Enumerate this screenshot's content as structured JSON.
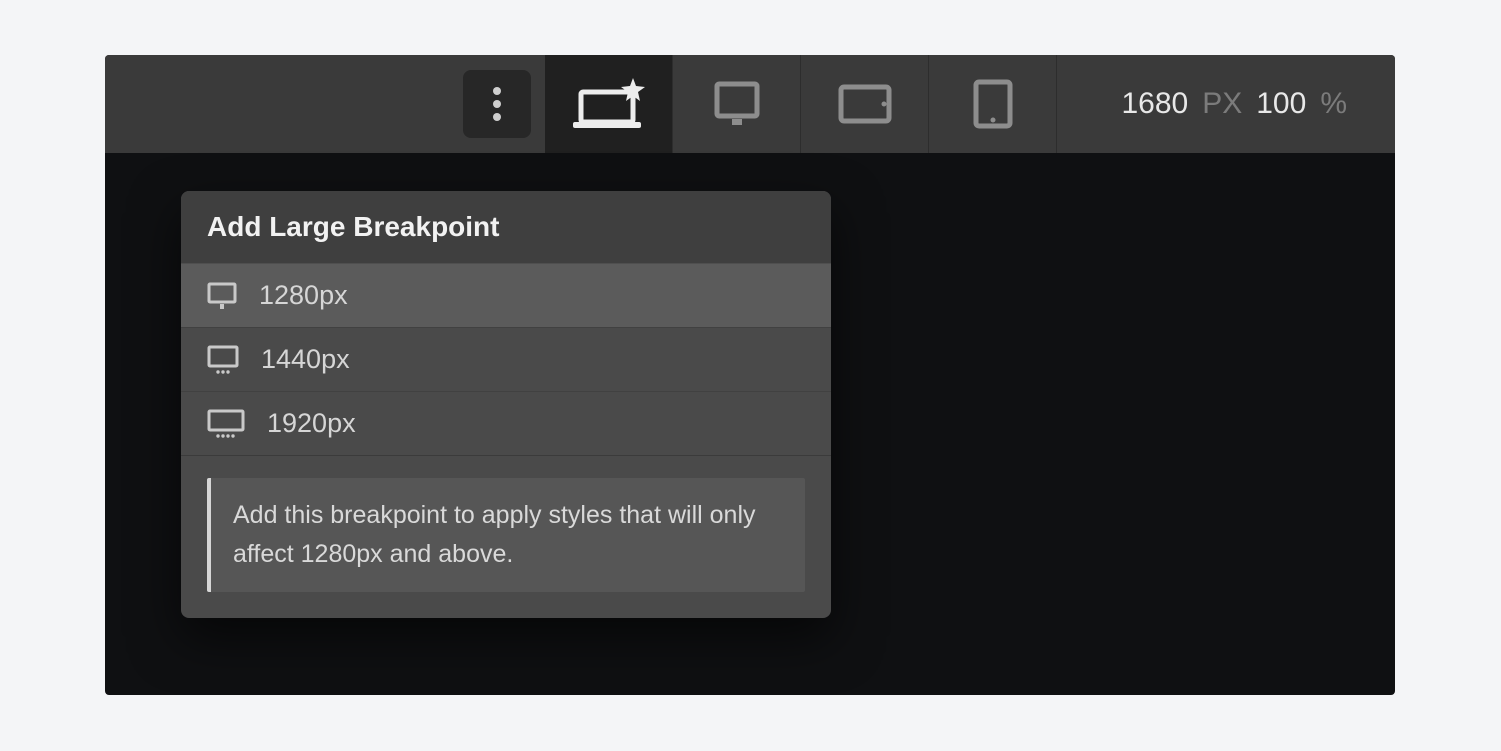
{
  "toolbar": {
    "width_value": "1680",
    "width_unit": "PX",
    "zoom_value": "100",
    "zoom_unit": "%"
  },
  "dropdown": {
    "title": "Add Large Breakpoint",
    "options": [
      {
        "label": "1280px"
      },
      {
        "label": "1440px"
      },
      {
        "label": "1920px"
      }
    ],
    "hint": "Add this breakpoint to apply styles that will only affect 1280px and above."
  }
}
